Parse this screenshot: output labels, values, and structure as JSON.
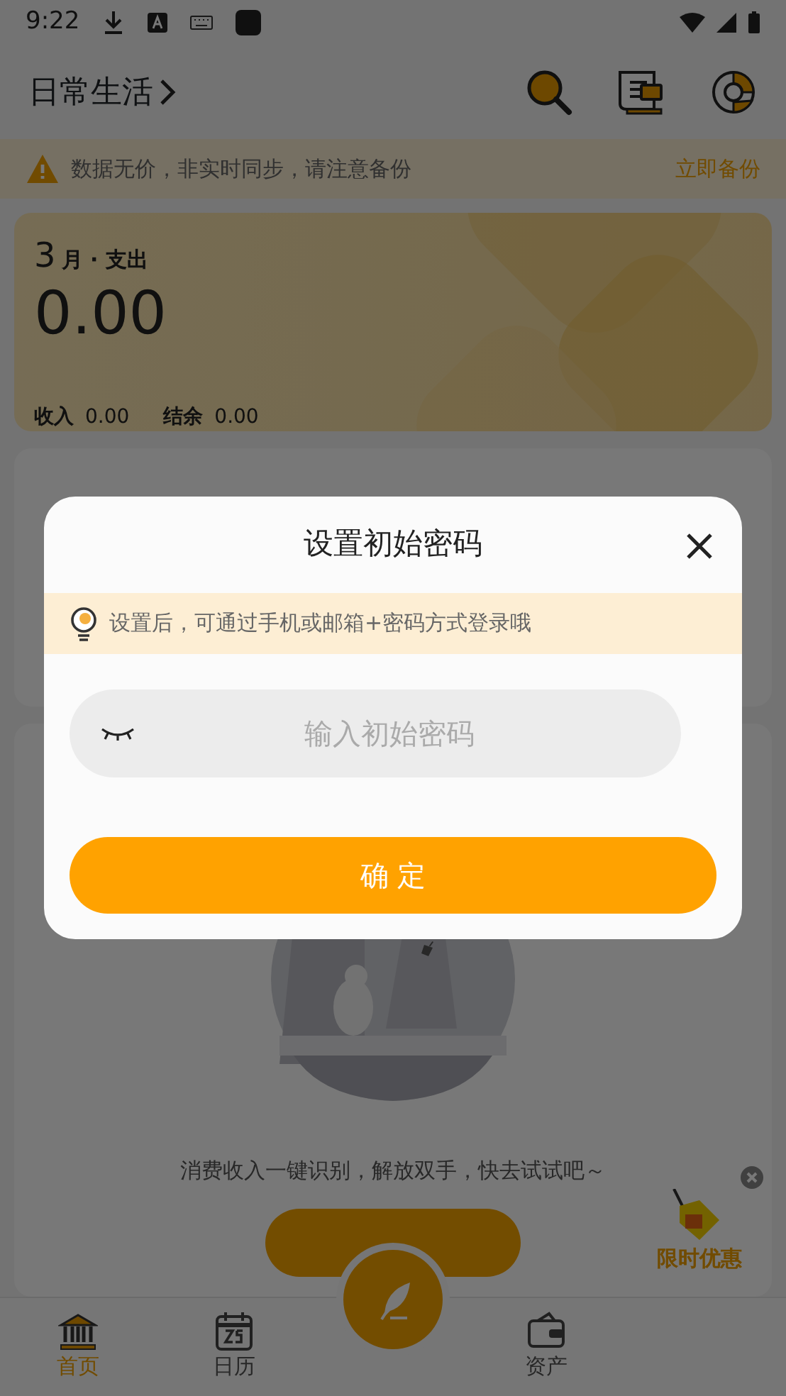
{
  "status_bar": {
    "time": "9:22"
  },
  "header": {
    "title": "日常生活"
  },
  "backup_notice": {
    "text": "数据无价，非实时同步，请注意备份",
    "action": "立即备份"
  },
  "summary": {
    "month": "3",
    "period": "月 · 支出",
    "amount": "0.00",
    "stats": [
      {
        "label": "收入",
        "value": "0.00"
      },
      {
        "label": "结余",
        "value": "0.00"
      }
    ]
  },
  "recent_card": {
    "hint": "消费收入一键识别，解放双手，快去试试吧～"
  },
  "promo": {
    "label": "限时优惠"
  },
  "tab_bar": [
    {
      "kind": "tab",
      "label": "首页",
      "selected": true
    },
    {
      "kind": "tab",
      "label": "日历",
      "selected": false
    },
    {
      "kind": "fab"
    },
    {
      "kind": "tab",
      "label": "资产",
      "selected": false
    }
  ],
  "dialog": {
    "title": "设置初始密码",
    "tip": "设置后，可通过手机或邮箱+密码方式登录哦",
    "password": {
      "placeholder": "输入初始密码",
      "masked": true
    },
    "confirm": "确 定"
  }
}
